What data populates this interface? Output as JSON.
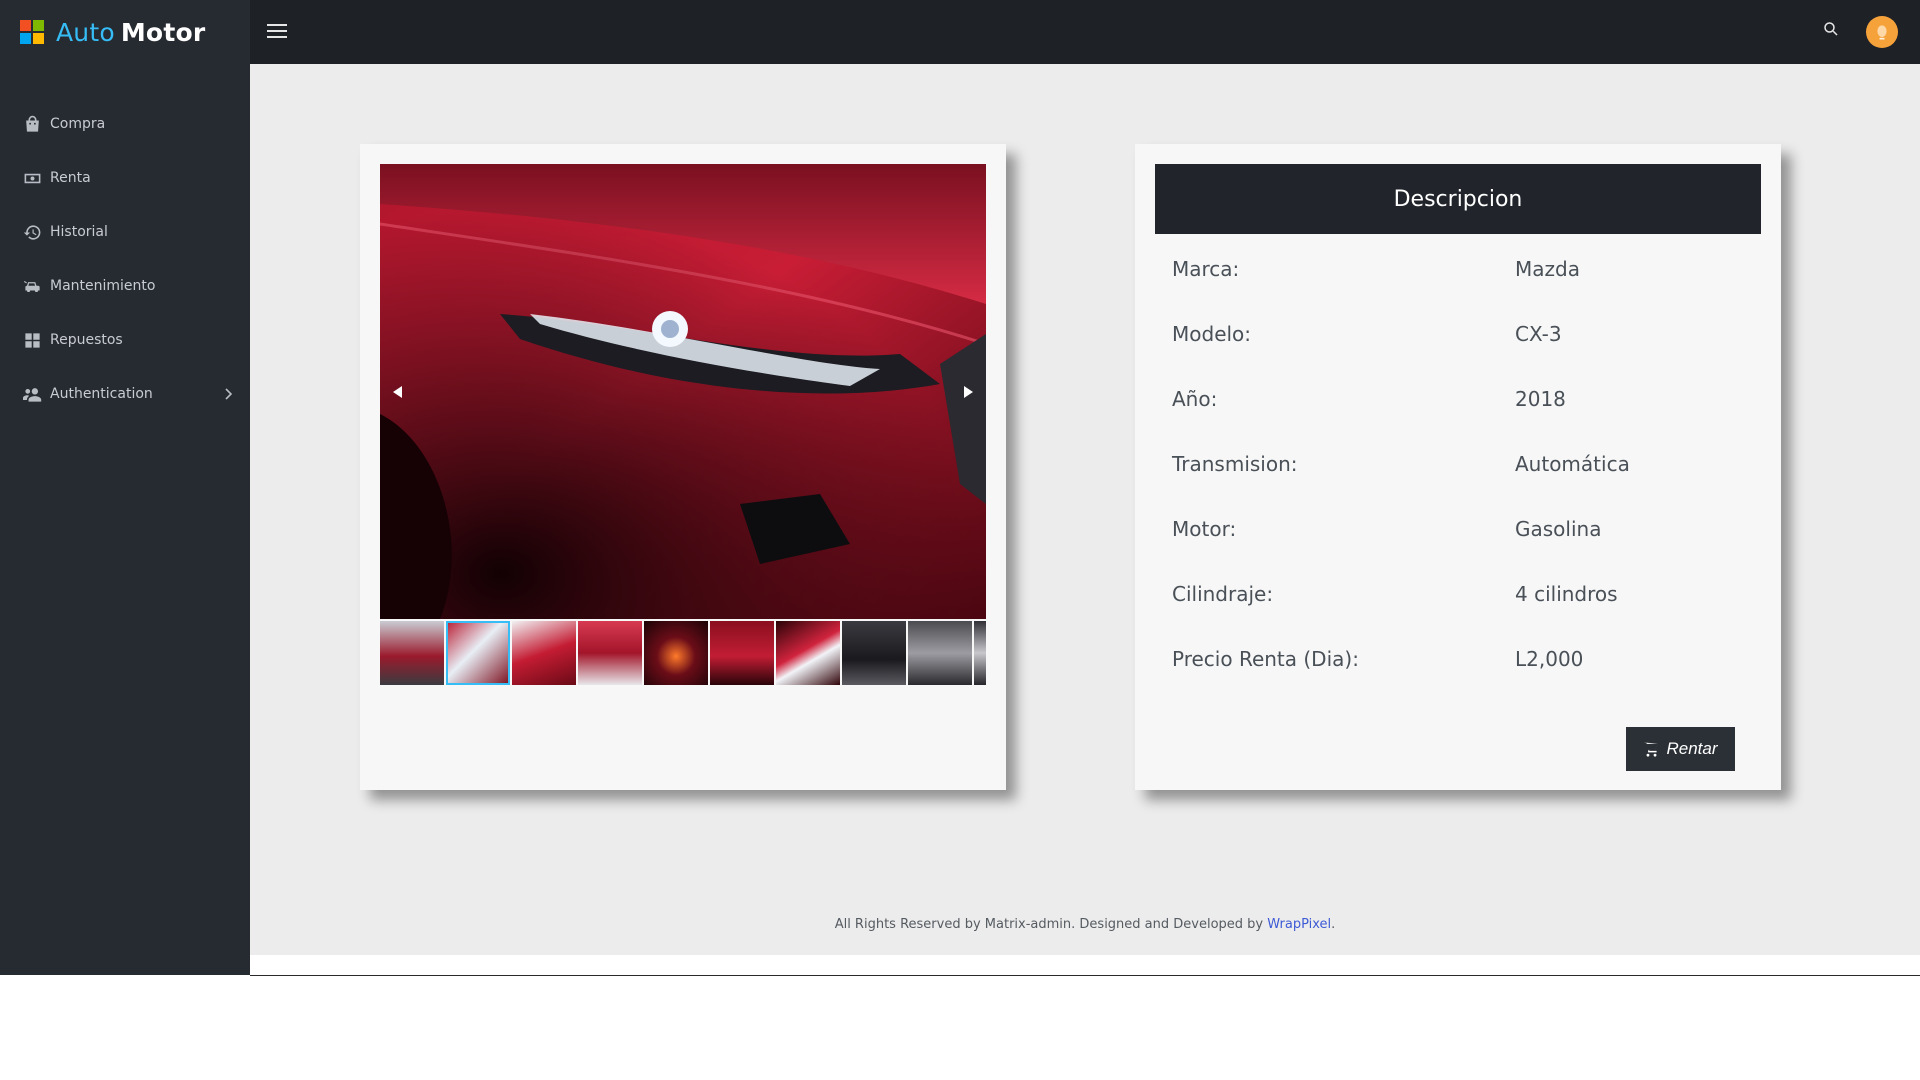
{
  "app": {
    "logo_part1": "Auto",
    "logo_part2": "Motor",
    "logo_colors": [
      "#f25022",
      "#7fba00",
      "#00a4ef",
      "#ffb900"
    ]
  },
  "sidebar": {
    "items": [
      {
        "label": "Compra",
        "icon": "shopping-bag-icon"
      },
      {
        "label": "Renta",
        "icon": "cash-icon"
      },
      {
        "label": "Historial",
        "icon": "history-icon"
      },
      {
        "label": "Mantenimiento",
        "icon": "car-wrench-icon"
      },
      {
        "label": "Repuestos",
        "icon": "grid-icon"
      },
      {
        "label": "Authentication",
        "icon": "user-group-icon",
        "has_submenu": true
      }
    ]
  },
  "topbar": {
    "menu_icon": "hamburger-icon",
    "search_icon": "search-icon",
    "avatar_icon": "avatar-icon"
  },
  "gallery": {
    "active_thumbnail": 2,
    "thumbnail_count": 10
  },
  "description": {
    "title": "Descripcion",
    "rows": [
      {
        "label": "Marca:",
        "value": "Mazda"
      },
      {
        "label": "Modelo:",
        "value": "CX-3"
      },
      {
        "label": "Año:",
        "value": "2018"
      },
      {
        "label": "Transmision:",
        "value": "Automática"
      },
      {
        "label": "Motor:",
        "value": "Gasolina"
      },
      {
        "label": "Cilindraje:",
        "value": "4 cilindros"
      },
      {
        "label": "Precio Renta (Dia):",
        "value": "L2,000"
      }
    ],
    "button_label": "Rentar",
    "button_icon": "cart-icon"
  },
  "footer": {
    "text": "All Rights Reserved by Matrix-admin. Designed and Developed by ",
    "link": "WrapPixel",
    "suffix": "."
  },
  "colors": {
    "sidebar_bg": "#262a31",
    "topbar_bg": "#1e2126",
    "accent": "#36bdf5",
    "header_bg": "#21252b",
    "button_bg": "#2b3036",
    "avatar_bg": "#f6a23b"
  }
}
